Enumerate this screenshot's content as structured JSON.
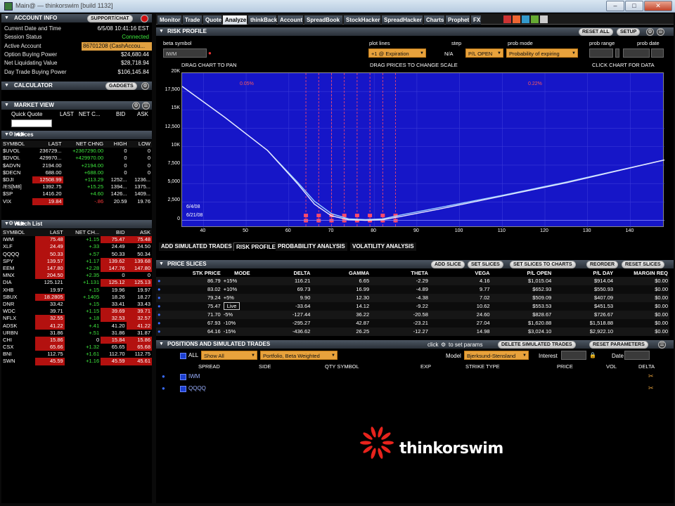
{
  "window": {
    "title": "Main@ — thinkorswim [build 1132]"
  },
  "account_info": {
    "header": "ACCOUNT INFO",
    "support_button": "SUPPORT/CHAT",
    "rows": [
      {
        "label": "Current Date and Time",
        "value": "6/5/08 10:41:16 EST",
        "style": ""
      },
      {
        "label": "Session Status",
        "value": "Connected",
        "style": "green"
      },
      {
        "label": "Active Account",
        "value": "86701208 (CashAccou...",
        "style": "orange"
      },
      {
        "label": "Option Buying Power",
        "value": "$24,680.44",
        "style": ""
      },
      {
        "label": "Net Liquidating Value",
        "value": "$28,718.94",
        "style": ""
      },
      {
        "label": "Day Trade Buying Power",
        "value": "$106,145.84",
        "style": ""
      }
    ]
  },
  "calculator": {
    "header": "CALCULATOR",
    "gadgets_button": "GADGETS"
  },
  "market_view": {
    "header": "MARKET VIEW",
    "quick_quote": {
      "label": "Quick Quote",
      "cols": [
        "LAST",
        "NET C...",
        "BID",
        "ASK"
      ]
    }
  },
  "indices": {
    "header": "Indices",
    "columns": [
      "SYMBOL",
      "LAST",
      "NET CHNG",
      "HIGH",
      "LOW"
    ],
    "rows": [
      {
        "sym": "$UVOL",
        "last": "236729...",
        "net": "+2367290.00",
        "high": "0",
        "low": "0",
        "dir": "up"
      },
      {
        "sym": "$DVOL",
        "last": "429970...",
        "net": "+429970.00",
        "high": "0",
        "low": "0",
        "dir": "up"
      },
      {
        "sym": "$ADVN",
        "last": "2194.00",
        "net": "+2194.00",
        "high": "0",
        "low": "0",
        "dir": "up"
      },
      {
        "sym": "$DECN",
        "last": "688.00",
        "net": "+688.00",
        "high": "0",
        "low": "0",
        "dir": "up"
      },
      {
        "sym": "$DJI",
        "last": "12508.99",
        "net": "+113.29",
        "high": "1252...",
        "low": "1236...",
        "dir": "dnlast"
      },
      {
        "sym": "/ES[M8]",
        "last": "1392.75",
        "net": "+15.25",
        "high": "1394...",
        "low": "1375...",
        "dir": "up"
      },
      {
        "sym": "$SP",
        "last": "1416.20",
        "net": "+4.60",
        "high": "1426...",
        "low": "1409...",
        "dir": "up"
      },
      {
        "sym": "VIX",
        "last": "19.84",
        "net": "-.86",
        "high": "20.59",
        "low": "19.76",
        "dir": "dn"
      }
    ]
  },
  "watch_list": {
    "header": "Watch List",
    "columns": [
      "SYMBOL",
      "LAST",
      "NET CH...",
      "BID",
      "ASK"
    ],
    "rows": [
      {
        "sym": "IWM",
        "last": "75.48",
        "net": "+1.15",
        "bid": "75.47",
        "ask": "75.48",
        "lc": "dn",
        "bc": "dn",
        "ac": "dn"
      },
      {
        "sym": "XLF",
        "last": "24.49",
        "net": "+.33",
        "bid": "24.49",
        "ask": "24.50",
        "lc": "dn",
        "bc": "",
        "ac": ""
      },
      {
        "sym": "QQQQ",
        "last": "50.33",
        "net": "+.57",
        "bid": "50.33",
        "ask": "50.34",
        "lc": "dn",
        "bc": "",
        "ac": ""
      },
      {
        "sym": "SPY",
        "last": "139.57",
        "net": "+1.17",
        "bid": "139.62",
        "ask": "139.68",
        "lc": "dn",
        "bc": "dn",
        "ac": "dn"
      },
      {
        "sym": "EEM",
        "last": "147.80",
        "net": "+2.28",
        "bid": "147.76",
        "ask": "147.80",
        "lc": "dn",
        "bc": "dn",
        "ac": "dn"
      },
      {
        "sym": "MNX",
        "last": "204.50",
        "net": "+2.35",
        "bid": "0",
        "ask": "0",
        "lc": "dn",
        "bc": "",
        "ac": ""
      },
      {
        "sym": "DIA",
        "last": "125.121",
        "net": "+1.131",
        "bid": "125.12",
        "ask": "125.13",
        "lc": "",
        "bc": "dn",
        "ac": "dn"
      },
      {
        "sym": "XHB",
        "last": "19.97",
        "net": "+.15",
        "bid": "19.96",
        "ask": "19.97",
        "lc": "",
        "bc": "",
        "ac": ""
      },
      {
        "sym": "SBUX",
        "last": "18.2805",
        "net": "+.1405",
        "bid": "18.26",
        "ask": "18.27",
        "lc": "dn",
        "bc": "",
        "ac": ""
      },
      {
        "sym": "DNR",
        "last": "33.42",
        "net": "+.15",
        "bid": "33.41",
        "ask": "33.43",
        "lc": "",
        "bc": "",
        "ac": ""
      },
      {
        "sym": "WDC",
        "last": "39.71",
        "net": "+1.15",
        "bid": "39.69",
        "ask": "39.71",
        "lc": "",
        "bc": "dn",
        "ac": "dn"
      },
      {
        "sym": "NFLX",
        "last": "32.55",
        "net": "+.18",
        "bid": "32.53",
        "ask": "32.57",
        "lc": "dn",
        "bc": "dn",
        "ac": "dn"
      },
      {
        "sym": "ADSK",
        "last": "41.22",
        "net": "+.41",
        "bid": "41.20",
        "ask": "41.22",
        "lc": "dn",
        "bc": "",
        "ac": "dn"
      },
      {
        "sym": "URBN",
        "last": "31.86",
        "net": "+.51",
        "bid": "31.86",
        "ask": "31.87",
        "lc": "",
        "bc": "",
        "ac": ""
      },
      {
        "sym": "CHI",
        "last": "15.86",
        "net": "0",
        "bid": "15.84",
        "ask": "15.86",
        "lc": "dn",
        "bc": "dn",
        "ac": "dn"
      },
      {
        "sym": "CSX",
        "last": "65.66",
        "net": "+1.32",
        "bid": "65.65",
        "ask": "65.68",
        "lc": "dn",
        "bc": "",
        "ac": "dn"
      },
      {
        "sym": "BNI",
        "last": "112.75",
        "net": "+1.61",
        "bid": "112.70",
        "ask": "112.75",
        "lc": "",
        "bc": "",
        "ac": ""
      },
      {
        "sym": "SWN",
        "last": "45.59",
        "net": "+1.16",
        "bid": "45.59",
        "ask": "45.61",
        "lc": "dn",
        "bc": "dn",
        "ac": "dn"
      }
    ]
  },
  "tabs": [
    "Monitor",
    "Trade",
    "Quote",
    "Analyze",
    "thinkBack",
    "Account",
    "SpreadBook",
    "StockHacker",
    "SpreadHacker",
    "Charts",
    "Prophet",
    "FX"
  ],
  "active_tab": "Analyze",
  "risk_profile": {
    "header": "RISK PROFILE",
    "reset_all": "RESET ALL",
    "setup": "SETUP",
    "beta_symbol_label": "beta symbol",
    "beta_symbol_value": "IWM",
    "plot_lines_label": "plot lines",
    "plot_lines_value": "+1 @ Expiration",
    "step_label": "step",
    "step_value": "N/A",
    "pl_open_value": "P/L OPEN",
    "prob_mode_label": "prob mode",
    "prob_mode_value": "Probability of expiring",
    "prob_range_label": "prob range",
    "prob_date_label": "prob date",
    "drag_chart": "DRAG CHART TO PAN",
    "drag_prices": "DRAG PRICES TO CHANGE SCALE",
    "click_chart": "CLICK CHART FOR DATA",
    "date1": "6/4/08",
    "date2": "6/21/08",
    "pct_left": "0.05%",
    "pct_right": "0.22%"
  },
  "chart_data": {
    "type": "line",
    "xlim": [
      35,
      148
    ],
    "ylim": [
      -1000,
      20000
    ],
    "x_ticks": [
      40,
      50,
      60,
      70,
      80,
      90,
      100,
      110,
      120,
      130,
      140
    ],
    "y_ticks": [
      {
        "v": 20000,
        "label": "20K"
      },
      {
        "v": 17500,
        "label": "17,500"
      },
      {
        "v": 15000,
        "label": "15K"
      },
      {
        "v": 12500,
        "label": "12,500"
      },
      {
        "v": 10000,
        "label": "10K"
      },
      {
        "v": 7500,
        "label": "7,500"
      },
      {
        "v": 5000,
        "label": "5,000"
      },
      {
        "v": 2500,
        "label": "2,500"
      },
      {
        "v": 0,
        "label": "0"
      }
    ],
    "series": [
      {
        "x": [
          35,
          45,
          55,
          62,
          66,
          70,
          74,
          78,
          82,
          86,
          95,
          110,
          125,
          148
        ],
        "y": [
          18200,
          14000,
          9500,
          5200,
          2600,
          900,
          200,
          100,
          200,
          700,
          1700,
          3400,
          5200,
          8200
        ]
      },
      {
        "x": [
          35,
          45,
          55,
          62,
          66,
          70,
          74,
          78,
          82,
          86,
          95,
          110,
          125,
          148
        ],
        "y": [
          18200,
          14000,
          9500,
          5000,
          2200,
          600,
          80,
          0,
          80,
          500,
          1500,
          3300,
          5100,
          8200
        ]
      }
    ],
    "strike_lines": [
      64,
      67,
      70,
      73,
      76,
      79,
      82,
      85
    ]
  },
  "sub_tabs": [
    "ADD SIMULATED TRADES",
    "RISK PROFILE",
    "PROBABILITY ANALYSIS",
    "VOLATILITY ANALYSIS"
  ],
  "price_slices": {
    "header": "PRICE SLICES",
    "buttons": [
      "ADD SLICE",
      "SET SLICES",
      "SET SLICES TO CHARTS",
      "REORDER",
      "RESET SLICES"
    ],
    "columns": [
      "STK PRICE",
      "MODE",
      "DELTA",
      "GAMMA",
      "THETA",
      "VEGA",
      "P/L OPEN",
      "P/L DAY",
      "MARGIN REQ"
    ],
    "rows": [
      {
        "price": "86.79",
        "mode": "+15%",
        "delta": "116.21",
        "gamma": "6.65",
        "theta": "-2.29",
        "vega": "4.16",
        "plopen": "$1,015.04",
        "plday": "$914.04",
        "margin": "$0.00"
      },
      {
        "price": "83.02",
        "mode": "+10%",
        "delta": "69.73",
        "gamma": "16.99",
        "theta": "-4.89",
        "vega": "9.77",
        "plopen": "$652.93",
        "plday": "$550.93",
        "margin": "$0.00"
      },
      {
        "price": "79.24",
        "mode": "+5%",
        "delta": "9.90",
        "gamma": "12.30",
        "theta": "-4.38",
        "vega": "7.02",
        "plopen": "$509.09",
        "plday": "$407.09",
        "margin": "$0.00"
      },
      {
        "price": "75.47",
        "mode": "Live",
        "delta": "-33.64",
        "gamma": "14.12",
        "theta": "-9.22",
        "vega": "10.62",
        "plopen": "$553.53",
        "plday": "$451.53",
        "margin": "$0.00"
      },
      {
        "price": "71.70",
        "mode": "-5%",
        "delta": "-127.44",
        "gamma": "36.22",
        "theta": "-20.58",
        "vega": "24.60",
        "plopen": "$828.67",
        "plday": "$726.67",
        "margin": "$0.00"
      },
      {
        "price": "67.93",
        "mode": "-10%",
        "delta": "-295.27",
        "gamma": "42.87",
        "theta": "-23.21",
        "vega": "27.04",
        "plopen": "$1,620.88",
        "plday": "$1,518.88",
        "margin": "$0.00"
      },
      {
        "price": "64.16",
        "mode": "-15%",
        "delta": "-436.62",
        "gamma": "26.25",
        "theta": "-12.27",
        "vega": "14.98",
        "plopen": "$3,024.10",
        "plday": "$2,922.10",
        "margin": "$0.00"
      }
    ]
  },
  "positions": {
    "header": "POSITIONS AND SIMULATED TRADES",
    "click_hint": "click",
    "set_params": "to set params",
    "delete_btn": "DELETE SIMULATED TRADES",
    "reset_btn": "RESET PARAMETERS",
    "all_label": "ALL",
    "show_all": "Show All",
    "portfolio": "Portfolio, Beta Weighted",
    "model_label": "Model",
    "model_value": "Bjerksund-Stensland",
    "interest_label": "Interest",
    "date_label": "Date",
    "columns": [
      "SPREAD",
      "SIDE",
      "QTY SYMBOL",
      "EXP",
      "STRIKE TYPE",
      "PRICE",
      "VOL",
      "DELTA"
    ],
    "rows": [
      "IWM",
      "QQQQ"
    ]
  },
  "watermark": {
    "text": "thinkorswim",
    "color": "#e8231c"
  }
}
